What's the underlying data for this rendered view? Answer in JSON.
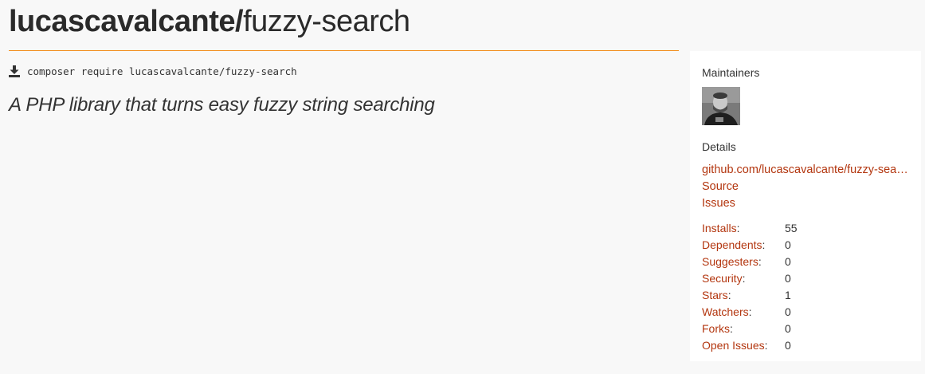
{
  "package": {
    "vendor": "lucascavalcante",
    "separator": "/",
    "name": "fuzzy-search",
    "install_command": "composer require lucascavalcante/fuzzy-search",
    "description": "A PHP library that turns easy fuzzy string searching"
  },
  "sidebar": {
    "maintainers_label": "Maintainers",
    "details_label": "Details",
    "links": [
      "github.com/lucascavalcante/fuzzy-search",
      "Source",
      "Issues"
    ],
    "stats": [
      {
        "label": "Installs",
        "value": "55"
      },
      {
        "label": "Dependents",
        "value": "0"
      },
      {
        "label": "Suggesters",
        "value": "0"
      },
      {
        "label": "Security",
        "value": "0"
      },
      {
        "label": "Stars",
        "value": "1"
      },
      {
        "label": "Watchers",
        "value": "0"
      },
      {
        "label": "Forks",
        "value": "0"
      },
      {
        "label": "Open Issues",
        "value": "0"
      }
    ]
  },
  "colors": {
    "accent_line": "#f28d1a",
    "link": "#b3360f",
    "background": "#f8f8f8"
  },
  "icons": {
    "install": "download-icon",
    "avatar": "avatar"
  }
}
